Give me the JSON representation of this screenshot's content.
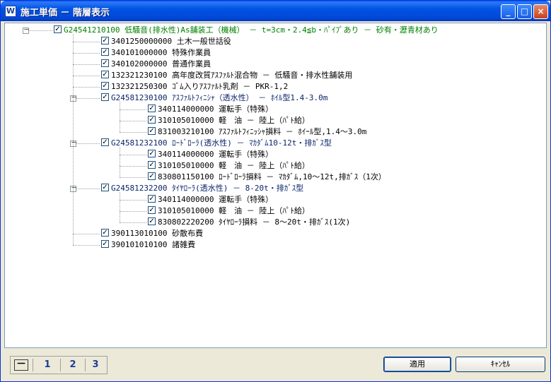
{
  "window": {
    "title": "施工単価 － 階層表示",
    "app_icon": "W",
    "buttons": {
      "minimize": "_",
      "maximize": "□",
      "close": "×"
    }
  },
  "tree": {
    "collapse_symbol": "－",
    "check_symbol": "✓",
    "root": {
      "label": "G24541210100 低騒音(排水性)As舗装工（機械） － t=3cm・2.4≦b・ﾊﾟｲﾌﾟあり － 砂有・瀝青材あり",
      "checked": true
    },
    "items": [
      {
        "label": "3401250000000 土木一般世話役",
        "checked": true
      },
      {
        "label": "340101000000 特殊作業員",
        "checked": true
      },
      {
        "label": "340102000000 普通作業員",
        "checked": true
      },
      {
        "label": "132321230100 高年度改質ｱｽﾌｧﾙﾄ混合物 － 低騒音・排水性舗装用",
        "checked": true
      },
      {
        "label": "132321250300 ｺﾞﾑ入りｱｽﾌｧﾙﾄ乳剤 － PKR-1,2",
        "checked": true
      },
      {
        "label": "G24581230100 ｱｽﾌｧﾙﾄﾌｨﾆｼｬ（透水性） － ﾎｲﾙ型1.4-3.0m",
        "checked": true,
        "group": true,
        "children": [
          {
            "label": "340114000000 運転手（特殊）",
            "checked": true
          },
          {
            "label": "310105010000 軽　油 － 陸上（ﾊﾟﾄ給）",
            "checked": true
          },
          {
            "label": "831003210100 ｱｽﾌｧﾙﾄﾌｨﾆｯｼｬ損料 － ﾎｲｰﾙ型,1.4～3.0m",
            "checked": true
          }
        ]
      },
      {
        "label": "G24581232100 ﾛｰﾄﾞﾛｰﾗ(透水性) － ﾏｶﾀﾞﾑ10-12t・排ｶﾞｽ型",
        "checked": true,
        "group": true,
        "children": [
          {
            "label": "340114000000 運転手（特殊）",
            "checked": true
          },
          {
            "label": "310105010000 軽　油 － 陸上（ﾊﾟﾄ給）",
            "checked": true
          },
          {
            "label": "830801150100 ﾛｰﾄﾞﾛｰﾗ損料 － ﾏｶﾀﾞﾑ,10～12t,排ｶﾞｽ（1次）",
            "checked": true
          }
        ]
      },
      {
        "label": "G24581232200 ﾀｲﾔﾛｰﾗ(透水性) － 8-20t・排ｶﾞｽ型",
        "checked": true,
        "group": true,
        "children": [
          {
            "label": "340114000000 運転手（特殊）",
            "checked": true
          },
          {
            "label": "310105010000 軽　油 － 陸上（ﾊﾟﾄ給）",
            "checked": true
          },
          {
            "label": "830802220200 ﾀｲﾔﾛｰﾗ損料 － 8～20t・排ｶﾞｽ(1次)",
            "checked": true
          }
        ]
      },
      {
        "label": "390113010100 砂散布費",
        "checked": true
      },
      {
        "label": "390101010100 諸雑費",
        "checked": true
      }
    ]
  },
  "footer": {
    "level_collapse": "－",
    "levels": [
      "1",
      "2",
      "3"
    ],
    "apply_label": "適用",
    "cancel_label": "ｷｬﾝｾﾙ"
  },
  "colors": {
    "root_text": "#008000",
    "group_text": "#0a246a",
    "titlebar": "#0054e3"
  }
}
